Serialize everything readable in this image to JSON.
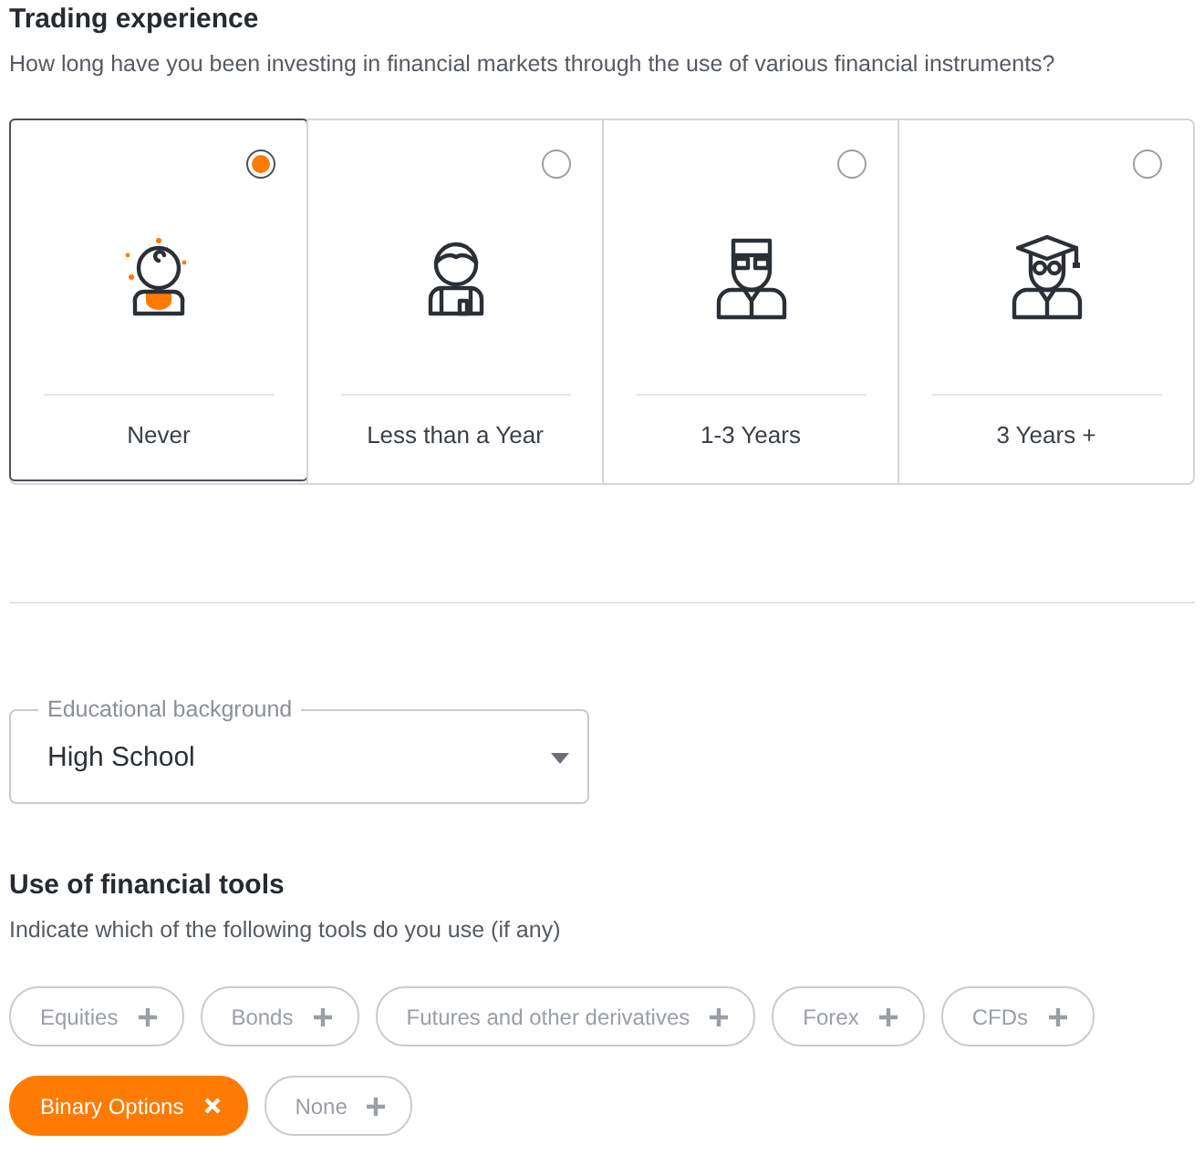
{
  "experience": {
    "title": "Trading experience",
    "description": "How long have you been investing in financial markets through the use of various financial instruments?",
    "options": [
      {
        "label": "Never",
        "kind": "baby",
        "selected": true
      },
      {
        "label": "Less than a Year",
        "kind": "child",
        "selected": false
      },
      {
        "label": "1-3 Years",
        "kind": "adult",
        "selected": false
      },
      {
        "label": "3 Years +",
        "kind": "graduate",
        "selected": false
      }
    ]
  },
  "education": {
    "label": "Educational background",
    "value": "High School"
  },
  "tools": {
    "title": "Use of financial tools",
    "description": "Indicate which of the following tools do you use (if any)",
    "chips": [
      {
        "label": "Equities",
        "selected": false
      },
      {
        "label": "Bonds",
        "selected": false
      },
      {
        "label": "Futures and other derivatives",
        "selected": false
      },
      {
        "label": "Forex",
        "selected": false
      },
      {
        "label": "CFDs",
        "selected": false
      },
      {
        "label": "Binary Options",
        "selected": true
      },
      {
        "label": "None",
        "selected": false
      }
    ]
  }
}
